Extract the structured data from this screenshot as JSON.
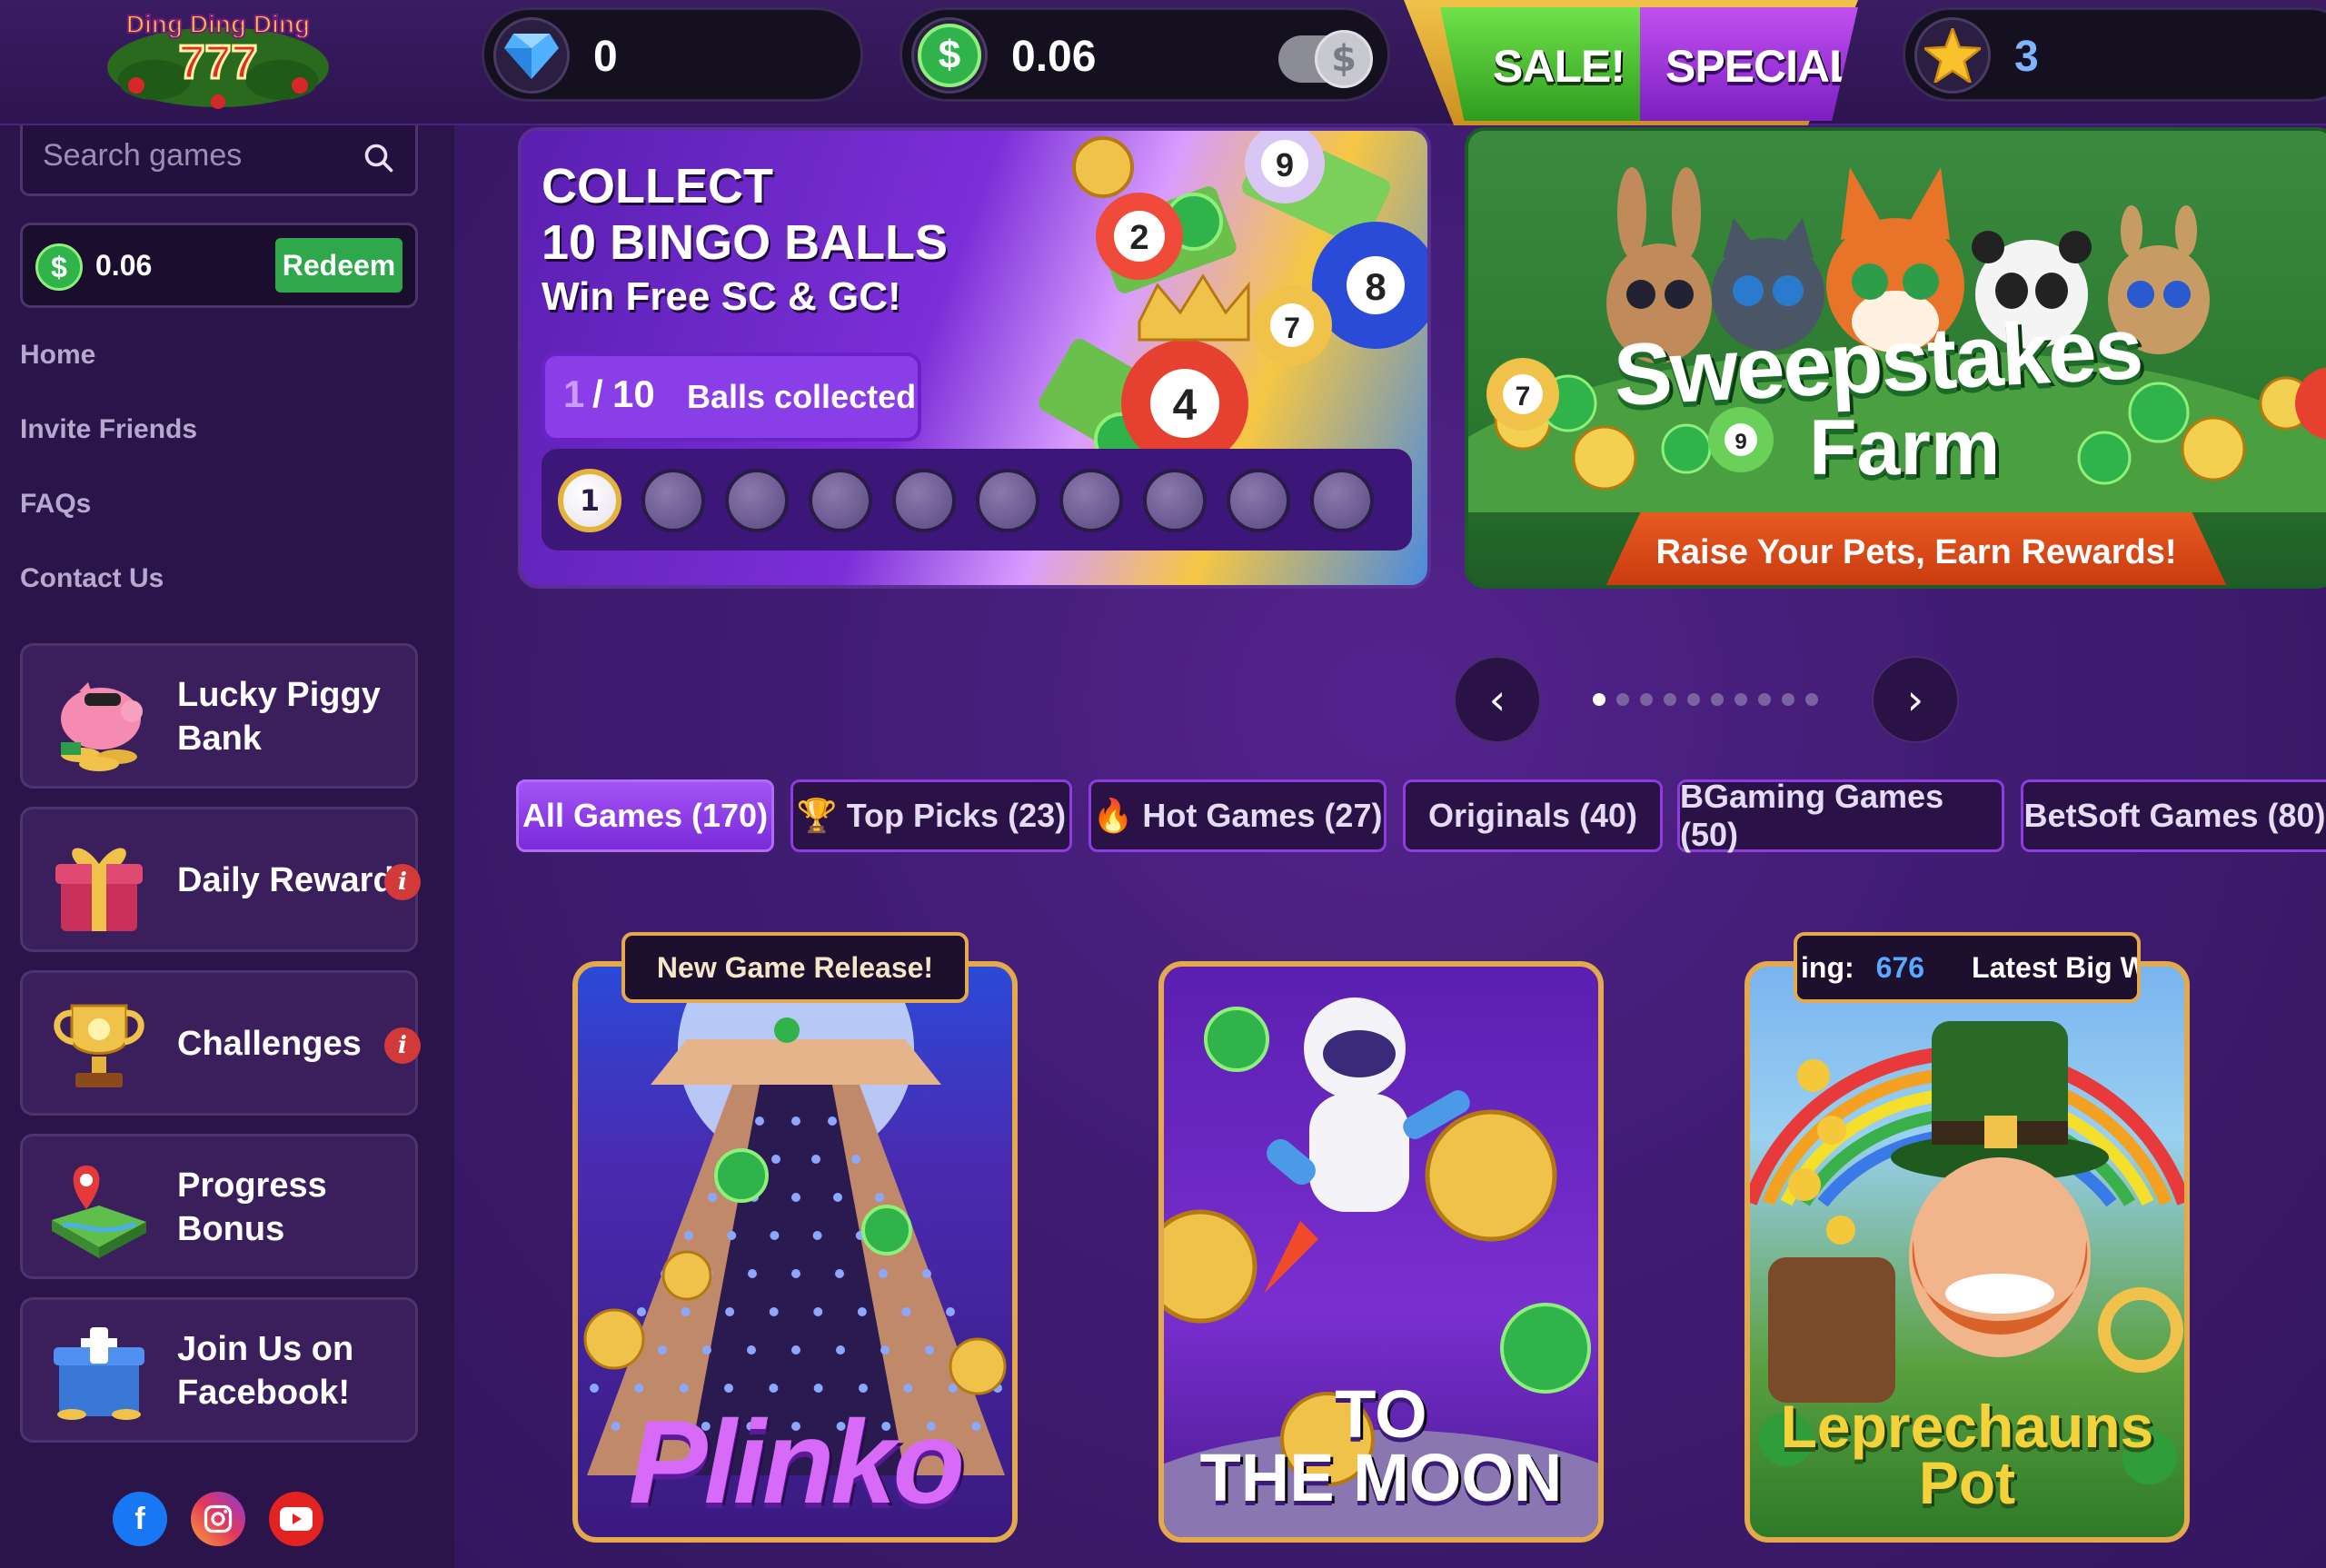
{
  "brand": {
    "logo_text": "Ding Ding Ding",
    "logo_number": "777"
  },
  "topbar": {
    "gems": "0",
    "sweeps_balance": "0.06",
    "sale_label": "SALE!",
    "special_label": "SPECIAL",
    "stars": "3"
  },
  "sidebar": {
    "search_placeholder": "Search games",
    "balance": "0.06",
    "redeem_label": "Redeem",
    "nav": [
      "Home",
      "Invite Friends",
      "FAQs",
      "Contact Us"
    ],
    "cards": [
      {
        "label_l1": "Lucky Piggy",
        "label_l2": "Bank",
        "icon": "piggy-bank-icon",
        "badge": false
      },
      {
        "label_l1": "Daily Rewards",
        "label_l2": "",
        "icon": "gift-box-icon",
        "badge": true
      },
      {
        "label_l1": "Challenges",
        "label_l2": "",
        "icon": "trophy-icon",
        "badge": true
      },
      {
        "label_l1": "Progress",
        "label_l2": "Bonus",
        "icon": "map-pin-icon",
        "badge": false
      },
      {
        "label_l1": "Join Us on",
        "label_l2": "Facebook!",
        "icon": "facebook-gift-icon",
        "badge": false
      }
    ],
    "info_glyph": "i",
    "social": [
      "facebook-icon",
      "instagram-icon",
      "youtube-icon"
    ]
  },
  "banners": {
    "bingo": {
      "title_l1": "COLLECT",
      "title_l2": "10 BINGO BALLS",
      "subtitle": "Win Free SC & GC!",
      "progress_current": "1",
      "progress_sep": "/",
      "progress_total": "10",
      "progress_label": "Balls collected",
      "balls_collected": 1,
      "balls_total": 10,
      "first_ball_number": "1",
      "deco_ball_numbers": [
        "9",
        "2",
        "8",
        "7",
        "4"
      ]
    },
    "farm": {
      "title_l1": "Sweepstakes",
      "title_l2": "Farm",
      "ribbon": "Raise Your Pets, Earn Rewards!",
      "deco_ball_numbers": [
        "7",
        "9"
      ]
    },
    "carousel_dots": 10,
    "carousel_active": 0,
    "prev_glyph": "‹",
    "next_glyph": "›"
  },
  "tabs": [
    {
      "label": "All Games (170)",
      "icon": "",
      "active": true
    },
    {
      "label": "Top Picks (23)",
      "icon": "🏆",
      "active": false
    },
    {
      "label": "Hot Games (27)",
      "icon": "🔥",
      "active": false
    },
    {
      "label": "Originals (40)",
      "icon": "",
      "active": false
    },
    {
      "label": "BGaming Games (50)",
      "icon": "",
      "active": false
    },
    {
      "label": "BetSoft Games (80)",
      "icon": "",
      "active": false
    }
  ],
  "games": [
    {
      "tag": "New Game Release!",
      "title_l1": "Plinko",
      "title_l2": ""
    },
    {
      "tag": "",
      "title_l1": "TO",
      "title_l2": "THE MOON"
    },
    {
      "tag_prefix": "ing:",
      "tag_count": "676",
      "tag_suffix": "Latest Big Win:",
      "title_l1": "Leprechauns",
      "title_l2": "Pot"
    }
  ],
  "icons": {
    "coin": "$",
    "search": "⌕"
  },
  "colors": {
    "accent_purple": "#8d3ce0",
    "redeem_green": "#2ea84a",
    "gold_border": "#e4a94a",
    "badge_red": "#d23a3a"
  }
}
